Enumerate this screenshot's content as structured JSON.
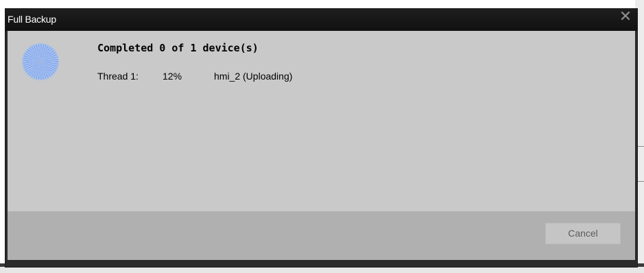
{
  "dialog": {
    "title": "Full Backup",
    "close_icon": "close-x-icon"
  },
  "progress": {
    "spinner_icon": "busy-spinner-icon",
    "heading": "Completed 0 of 1 device(s)",
    "threads": [
      {
        "label": "Thread 1:",
        "percent": "12%",
        "device_status": "hmi_2 (Uploading)"
      }
    ]
  },
  "footer": {
    "cancel_label": "Cancel"
  },
  "colors": {
    "titlebar": "#151515",
    "body": "#c9c9c9",
    "footer": "#b0b0b0",
    "spinner": "#8fb0f0"
  }
}
